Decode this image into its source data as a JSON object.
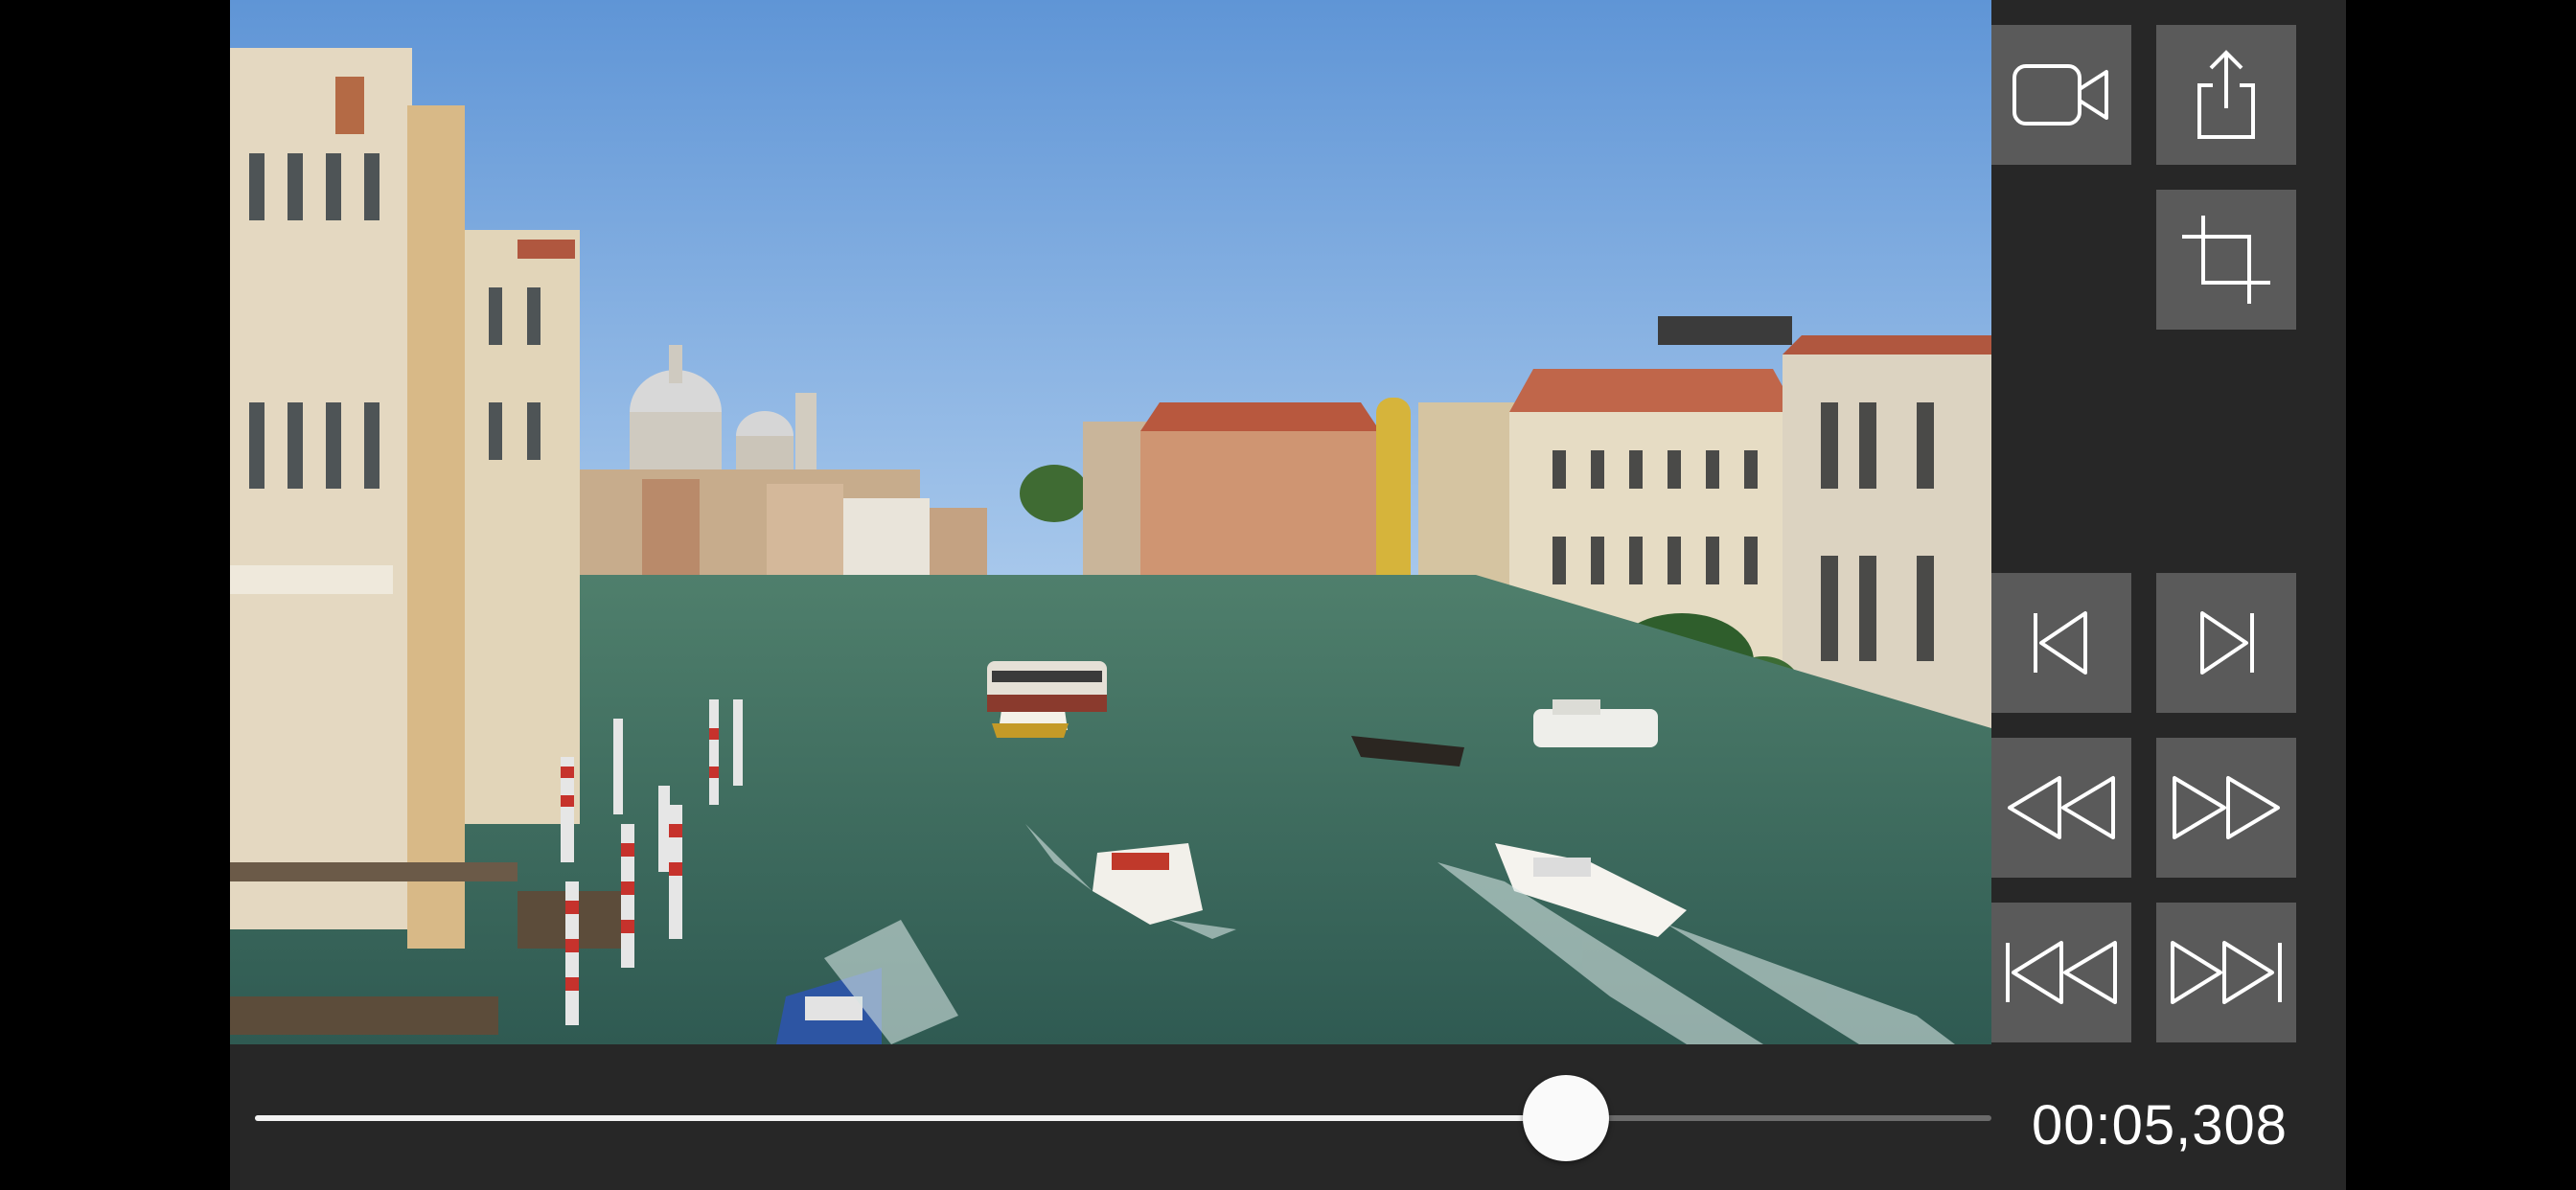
{
  "player": {
    "current_time": "00:05,308",
    "progress": 0.755
  },
  "toolbar": {
    "buttons": [
      {
        "name": "record",
        "icon": "video-camera-icon"
      },
      {
        "name": "share",
        "icon": "share-icon"
      },
      {
        "name": "crop",
        "icon": "crop-icon"
      },
      {
        "name": "previous-frame",
        "icon": "step-backward-icon"
      },
      {
        "name": "next-frame",
        "icon": "step-forward-icon"
      },
      {
        "name": "rewind",
        "icon": "rewind-icon"
      },
      {
        "name": "fast-forward",
        "icon": "fast-forward-icon"
      },
      {
        "name": "skip-to-start",
        "icon": "skip-to-start-icon"
      },
      {
        "name": "skip-to-end",
        "icon": "skip-to-end-icon"
      }
    ]
  },
  "colors": {
    "background": "#272727",
    "button": "#5a5a5a",
    "icon": "#ffffff",
    "track": "#6b6b6b",
    "track_fill": "#f2f2f2"
  }
}
